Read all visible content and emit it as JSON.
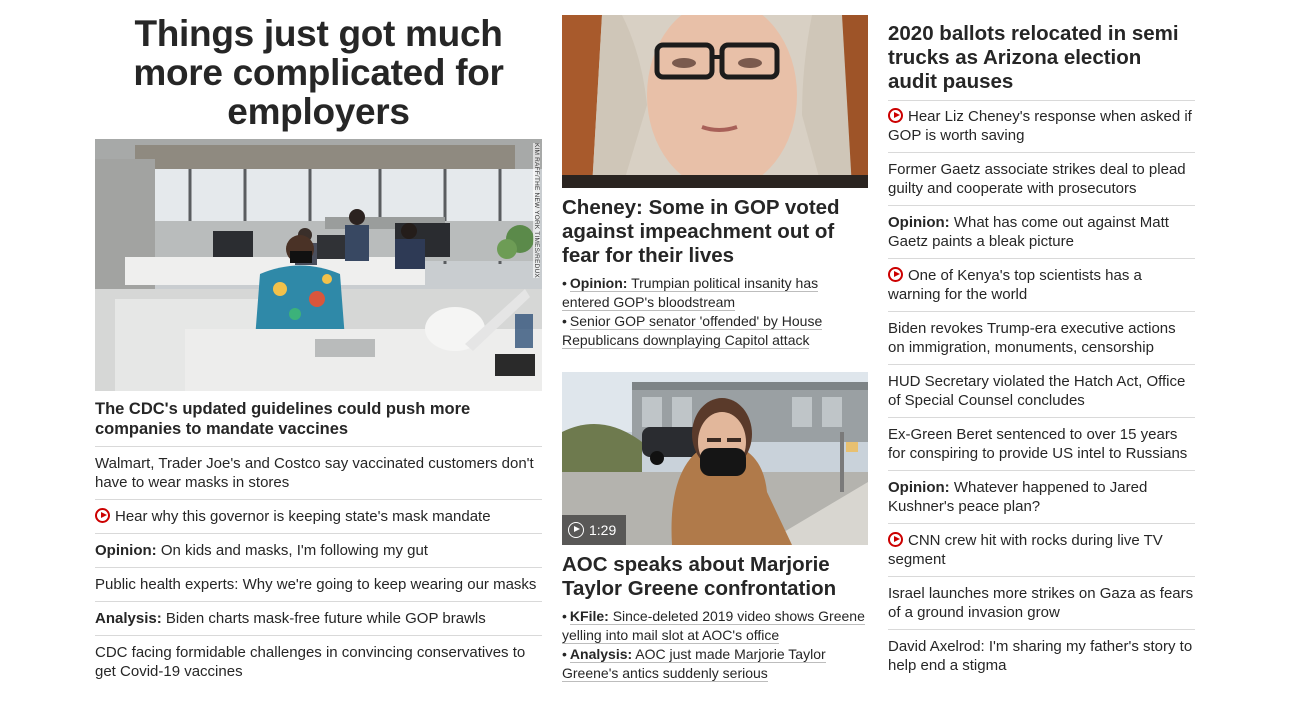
{
  "left": {
    "hero_title": "Things just got much more complicated for employers",
    "photo_credit": "KIM RAFF/THE NEW YORK TIMES/REDUX",
    "lead": "The CDC's updated guidelines could push more companies to mandate vaccines",
    "items": [
      {
        "kicker": "",
        "text": "Walmart, Trader Joe's and Costco say vaccinated customers don't have to wear masks in stores",
        "video": false
      },
      {
        "kicker": "",
        "text": "Hear why this governor is keeping state's mask mandate",
        "video": true
      },
      {
        "kicker": "Opinion:",
        "text": "On kids and masks, I'm following my gut",
        "video": false
      },
      {
        "kicker": "",
        "text": "Public health experts: Why we're going to keep wearing our masks",
        "video": false
      },
      {
        "kicker": "Analysis:",
        "text": "Biden charts mask-free future while GOP brawls",
        "video": false
      },
      {
        "kicker": "",
        "text": "CDC facing formidable challenges in convincing conservatives to get Covid-19 vaccines",
        "video": false
      }
    ]
  },
  "middle": {
    "story1": {
      "title": "Cheney: Some in GOP voted against impeachment out of fear for their lives",
      "subs": [
        {
          "kicker": "Opinion:",
          "text": "Trumpian political insanity has entered GOP's bloodstream"
        },
        {
          "kicker": "",
          "text": "Senior GOP senator 'offended' by House Republicans downplaying Capitol attack"
        }
      ]
    },
    "story2": {
      "duration": "1:29",
      "title": "AOC speaks about Marjorie Taylor Greene confrontation",
      "subs": [
        {
          "kicker": "KFile:",
          "text": "Since-deleted 2019 video shows Greene yelling into mail slot at AOC's office"
        },
        {
          "kicker": "Analysis:",
          "text": "AOC just made Marjorie Taylor Greene's antics suddenly serious"
        }
      ]
    }
  },
  "right": {
    "title": "2020 ballots relocated in semi trucks as Arizona election audit pauses",
    "items": [
      {
        "kicker": "",
        "text": "Hear Liz Cheney's response when asked if GOP is worth saving",
        "video": true
      },
      {
        "kicker": "",
        "text": "Former Gaetz associate strikes deal to plead guilty and cooperate with prosecutors",
        "video": false
      },
      {
        "kicker": "Opinion:",
        "text": "What has come out against Matt Gaetz paints a bleak picture",
        "video": false
      },
      {
        "kicker": "",
        "text": "One of Kenya's top scientists has a warning for the world",
        "video": true
      },
      {
        "kicker": "",
        "text": "Biden revokes Trump-era executive actions on immigration, monuments, censorship",
        "video": false
      },
      {
        "kicker": "",
        "text": "HUD Secretary violated the Hatch Act, Office of Special Counsel concludes",
        "video": false
      },
      {
        "kicker": "",
        "text": "Ex-Green Beret sentenced to over 15 years for conspiring to provide US intel to Russians",
        "video": false
      },
      {
        "kicker": "Opinion:",
        "text": "Whatever happened to Jared Kushner's peace plan?",
        "video": false
      },
      {
        "kicker": "",
        "text": "CNN crew hit with rocks during live TV segment",
        "video": true
      },
      {
        "kicker": "",
        "text": "Israel launches more strikes on Gaza as fears of a ground invasion grow",
        "video": false
      },
      {
        "kicker": "",
        "text": "David Axelrod: I'm sharing my father's story to help end a stigma",
        "video": false
      }
    ]
  },
  "colors": {
    "text": "#262626",
    "video_icon": "#cc0000",
    "divider": "#d9d9d9"
  }
}
